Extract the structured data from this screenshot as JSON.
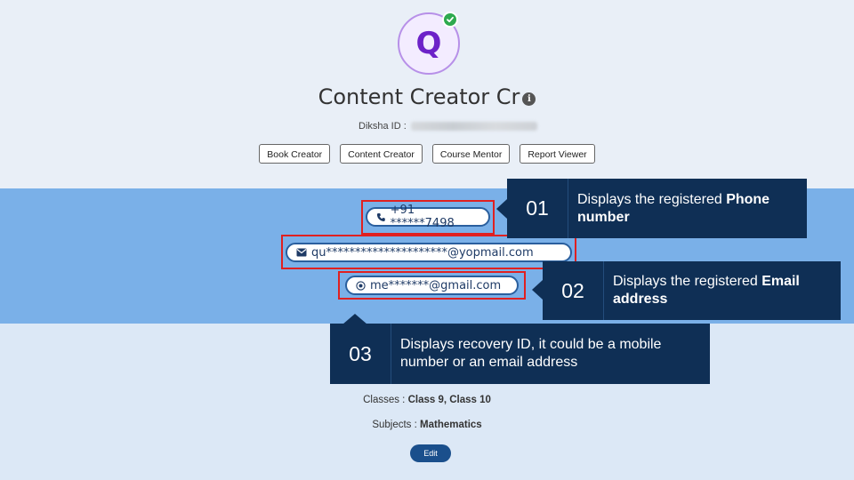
{
  "profile": {
    "avatar_letter": "Q",
    "name": "Content Creator Cr",
    "info_glyph": "i",
    "diksha_label": "Diksha ID :",
    "roles": [
      "Book Creator",
      "Content Creator",
      "Course Mentor",
      "Report Viewer"
    ]
  },
  "contacts": {
    "phone": "+91 ******7498",
    "email": "qu*********************@yopmail.com",
    "recovery": "me*******@gmail.com"
  },
  "callouts": [
    {
      "num": "01",
      "text": "Displays the registered ",
      "bold": "Phone number"
    },
    {
      "num": "02",
      "text": "Displays the registered ",
      "bold": "Email address"
    },
    {
      "num": "03",
      "text": "Displays recovery ID, it could be a mobile number or an email address",
      "bold": ""
    }
  ],
  "details": {
    "classes_label": "Classes : ",
    "classes_value": "Class 9, Class 10",
    "subjects_label": "Subjects : ",
    "subjects_value": "Mathematics"
  },
  "edit_label": "Edit",
  "colors": {
    "band_blue": "#7ab0e8",
    "callout_navy": "#0f2f55",
    "highlight_red": "#e02020",
    "avatar_purple": "#6c22c8",
    "verified_green": "#2eaa4f"
  },
  "icons": {
    "verified": "check-circle-icon",
    "info": "info-icon",
    "phone": "phone-icon",
    "email": "envelope-icon",
    "recovery": "recovery-icon"
  }
}
